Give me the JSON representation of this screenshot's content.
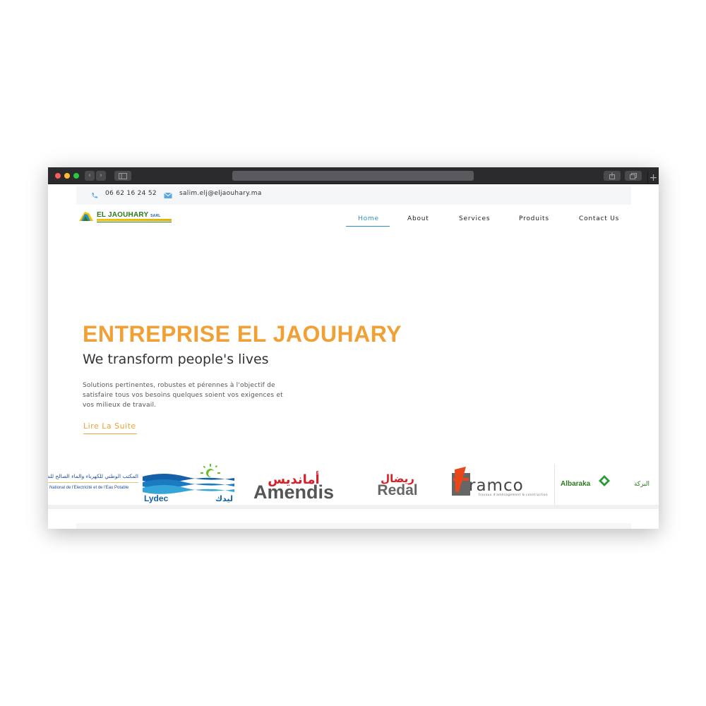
{
  "browser": {
    "controls": {
      "back": "‹",
      "forward": "›",
      "new_tab": "+"
    }
  },
  "contact": {
    "phone": "06 62 16 24 52",
    "email": "salim.elj@eljaouhary.ma"
  },
  "logo": {
    "name": "EL JAOUHARY",
    "suffix": "SARL"
  },
  "nav": {
    "items": [
      "Home",
      "About",
      "Services",
      "Produits",
      "Contact Us"
    ],
    "active": "Home"
  },
  "hero": {
    "title": "ENTREPRISE EL JAOUHARY",
    "subtitle": "We transform people's lives",
    "description": "Solutions pertinentes, robustes et pérennes à l'objectif de satisfaire tous vos besoins quelques soient vos exigences et vos milieux de travail.",
    "cta": "Lire La Suite"
  },
  "partners": [
    {
      "name": "onee",
      "text_ar": "المكتب الوطني للكهرباء والماء الصالح للشرب",
      "text_fr": "National de l'Electricité et de l'Eau Potable"
    },
    {
      "name": "lydec",
      "text_lat": "Lydec",
      "text_ar": "ليدك"
    },
    {
      "name": "amendis",
      "text_lat": "Amendis",
      "text_ar": "أمانديس"
    },
    {
      "name": "redal",
      "text_lat": "Redal",
      "text_ar": "ريضال"
    },
    {
      "name": "tramco",
      "text_lat": "ramco",
      "tagline": "travaux d'aménagement & construction"
    },
    {
      "name": "albaraka",
      "text_lat": "Albaraka",
      "text_ar": "البركة"
    }
  ],
  "colors": {
    "accent": "#f0a035",
    "nav_active": "#2a8fd1",
    "chrome": "#2b2b2d"
  }
}
